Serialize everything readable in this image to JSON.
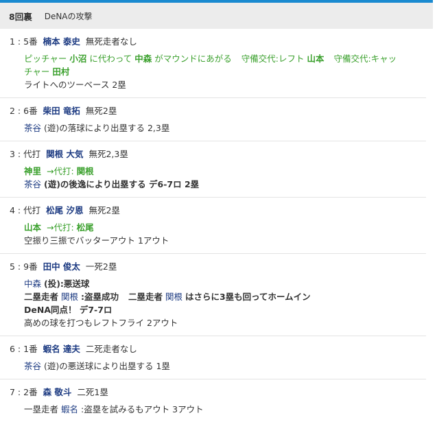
{
  "header": {
    "inning": "8回裏",
    "team_label": "DeNAの攻撃"
  },
  "plays": [
    {
      "index": "1 : ",
      "order": "5番",
      "batter": "楠本 泰史",
      "state": "無死走者なし",
      "sub1": {
        "p1": "ピッチャー",
        "n1": "小沼",
        "p2": "に代わって",
        "n2": "中森",
        "p3": "がマウンドにあがる",
        "p4": "守備交代:レフト",
        "n3": "山本",
        "p5": "守備交代:キャッ",
        "p6": "チャー",
        "n4": "田村"
      },
      "result": "ライトへのツーベース 2塁"
    },
    {
      "index": "2 : ",
      "order": "6番",
      "batter": "柴田 竜拓",
      "state": "無死2塁",
      "fielder": "茶谷",
      "result": "(遊)の落球により出塁する 2,3塁"
    },
    {
      "index": "3 : ",
      "order": "代打",
      "batter": "関根 大気",
      "state": "無死2,3塁",
      "sub_a": "神里",
      "sub_b": "→代打:",
      "sub_c": "関根",
      "fielder": "茶谷",
      "result": "(遊)の後逸により出塁する デ6-7ロ 2塁"
    },
    {
      "index": "4 : ",
      "order": "代打",
      "batter": "松尾 汐恩",
      "state": "無死2塁",
      "sub_a": "山本",
      "sub_b": "→代打:",
      "sub_c": "松尾",
      "result": "空振り三振でバッターアウト 1アウト"
    },
    {
      "index": "5 : ",
      "order": "9番",
      "batter": "田中 俊太",
      "state": "一死2塁",
      "fielder": "中森",
      "line1": "(投):悪送球",
      "r1a": "二塁走者",
      "r1b": "関根",
      "r1c": ":盗塁成功",
      "r2a": "二塁走者",
      "r2b": "関根",
      "r2c": "はさらに3塁も回ってホームイン",
      "line3": "DeNA同点！ デ7-7ロ",
      "line4": "高めの球を打つもレフトフライ 2アウト"
    },
    {
      "index": "6 : ",
      "order": "1番",
      "batter": "蝦名 達夫",
      "state": "二死走者なし",
      "fielder": "茶谷",
      "result": "(遊)の悪送球により出塁する 1塁"
    },
    {
      "index": "7 : ",
      "order": "2番",
      "batter": "森 敬斗",
      "state": "二死1塁",
      "r1a": "一塁走者",
      "r1b": "蝦名",
      "result": ":盗塁を試みるもアウト 3アウト"
    }
  ]
}
